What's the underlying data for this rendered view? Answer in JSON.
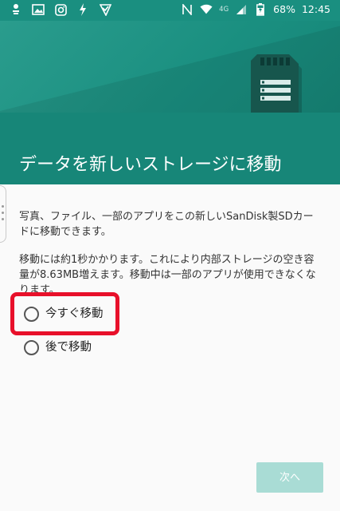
{
  "statusbar": {
    "network_type": "4G",
    "battery_percent": "68%",
    "time": "12:45",
    "icons": [
      "notification-icon",
      "image-icon",
      "instagram-icon",
      "flash-icon",
      "clipboard-check-icon",
      "nfc-icon",
      "wifi-icon",
      "signal-icon",
      "battery-charging-icon"
    ]
  },
  "header": {
    "title": "データを新しいストレージに移動"
  },
  "body": {
    "paragraph1": "写真、ファイル、一部のアプリをこの新しいSanDisk製SDカードに移動できます。",
    "paragraph2": "移動には約1秒かかります。これにより内部ストレージの空き容量が8.63MB増えます。移動中は一部のアプリが使用できなくなります。"
  },
  "options": [
    {
      "label": "今すぐ移動",
      "selected": false,
      "highlighted": true
    },
    {
      "label": "後で移動",
      "selected": false,
      "highlighted": false
    }
  ],
  "footer": {
    "next_label": "次へ",
    "next_enabled": false
  },
  "colors": {
    "accent": "#1a8f80",
    "title_band": "#178678",
    "highlight_box": "#e8102a",
    "next_button_disabled": "#a9dcd5"
  }
}
